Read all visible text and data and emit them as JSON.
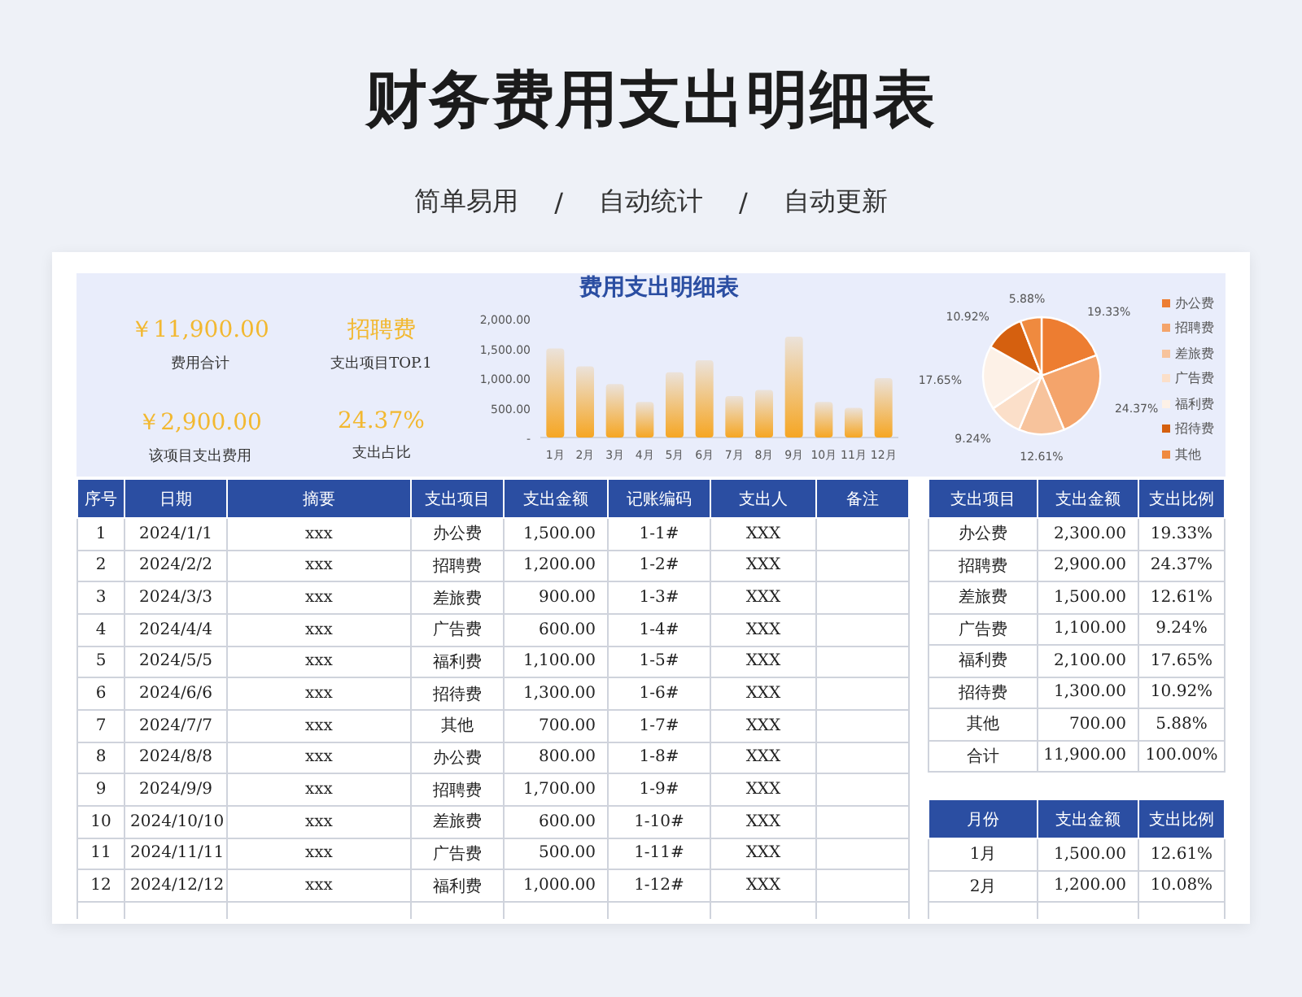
{
  "header": {
    "title": "财务费用支出明细表",
    "taglines": [
      "简单易用",
      "/",
      "自动统计",
      "/",
      "自动更新"
    ]
  },
  "dashboard": {
    "title": "费用支出明细表",
    "stats": [
      {
        "value": "￥11,900.00",
        "label": "费用合计"
      },
      {
        "value": "招聘费",
        "label": "支出项目TOP.1"
      },
      {
        "value": "￥2,900.00",
        "label": "该项目支出费用"
      },
      {
        "value": "24.37%",
        "label": "支出占比"
      }
    ],
    "bar_chart": {
      "chart_data": {
        "type": "bar",
        "categories": [
          "1月",
          "2月",
          "3月",
          "4月",
          "5月",
          "6月",
          "7月",
          "8月",
          "9月",
          "10月",
          "11月",
          "12月"
        ],
        "series": [
          {
            "color": "#f6a623",
            "values": [
              1500,
              1200,
              900,
              600,
              1100,
              1300,
              700,
              800,
              1700,
              600,
              500,
              1000
            ]
          }
        ],
        "ylim": [
          0,
          2000
        ],
        "yticks": [
          {
            "value": 0,
            "label": "-"
          },
          {
            "value": 500,
            "label": "500.00"
          },
          {
            "value": 1000,
            "label": "1,000.00"
          },
          {
            "value": 1500,
            "label": "1,500.00"
          },
          {
            "value": 2000,
            "label": "2,000.00"
          }
        ]
      }
    },
    "pie_chart": {
      "chart_data": {
        "type": "pie",
        "categories": [
          "办公费",
          "招聘费",
          "差旅费",
          "广告费",
          "福利费",
          "招待费",
          "其他"
        ],
        "series": [
          {
            "values": [
              19.33,
              24.37,
              12.61,
              9.24,
              17.65,
              10.92,
              5.88
            ]
          }
        ],
        "value_labels": [
          "19.33%",
          "24.37%",
          "12.61%",
          "9.24%",
          "17.65%",
          "10.92%",
          "5.88%"
        ]
      },
      "legend": [
        {
          "color": "#ed7d31"
        },
        {
          "color": "#f4a46b"
        },
        {
          "color": "#f7c39c"
        },
        {
          "color": "#fbdfc9"
        },
        {
          "color": "#fdf1e7"
        },
        {
          "color": "#d5600f"
        },
        {
          "color": "#ef8a3f"
        }
      ]
    }
  },
  "expense_table": {
    "columns": [
      "序号",
      "日期",
      "摘要",
      "支出项目",
      "支出金额",
      "记账编码",
      "支出人",
      "备注"
    ],
    "rows": [
      [
        "1",
        "2024/1/1",
        "xxx",
        "办公费",
        "1,500.00",
        "1-1#",
        "XXX"
      ],
      [
        "2",
        "2024/2/2",
        "xxx",
        "招聘费",
        "1,200.00",
        "1-2#",
        "XXX"
      ],
      [
        "3",
        "2024/3/3",
        "xxx",
        "差旅费",
        "900.00",
        "1-3#",
        "XXX"
      ],
      [
        "4",
        "2024/4/4",
        "xxx",
        "广告费",
        "600.00",
        "1-4#",
        "XXX"
      ],
      [
        "5",
        "2024/5/5",
        "xxx",
        "福利费",
        "1,100.00",
        "1-5#",
        "XXX"
      ],
      [
        "6",
        "2024/6/6",
        "xxx",
        "招待费",
        "1,300.00",
        "1-6#",
        "XXX"
      ],
      [
        "7",
        "2024/7/7",
        "xxx",
        "其他",
        "700.00",
        "1-7#",
        "XXX"
      ],
      [
        "8",
        "2024/8/8",
        "xxx",
        "办公费",
        "800.00",
        "1-8#",
        "XXX"
      ],
      [
        "9",
        "2024/9/9",
        "xxx",
        "招聘费",
        "1,700.00",
        "1-9#",
        "XXX"
      ],
      [
        "10",
        "2024/10/10",
        "xxx",
        "差旅费",
        "600.00",
        "1-10#",
        "XXX"
      ],
      [
        "11",
        "2024/11/11",
        "xxx",
        "广告费",
        "500.00",
        "1-11#",
        "XXX"
      ],
      [
        "12",
        "2024/12/12",
        "xxx",
        "福利费",
        "1,000.00",
        "1-12#",
        "XXX"
      ]
    ]
  },
  "category_table": {
    "columns": [
      "支出项目",
      "支出金额",
      "支出比例"
    ],
    "rows": [
      [
        "办公费",
        "2,300.00",
        "19.33%"
      ],
      [
        "招聘费",
        "2,900.00",
        "24.37%"
      ],
      [
        "差旅费",
        "1,500.00",
        "12.61%"
      ],
      [
        "广告费",
        "1,100.00",
        "9.24%"
      ],
      [
        "福利费",
        "2,100.00",
        "17.65%"
      ],
      [
        "招待费",
        "1,300.00",
        "10.92%"
      ],
      [
        "其他",
        "700.00",
        "5.88%"
      ],
      [
        "合计",
        "11,900.00",
        "100.00%"
      ]
    ]
  },
  "monthly_table": {
    "columns": [
      "月份",
      "支出金额",
      "支出比例"
    ],
    "rows": [
      [
        "1月",
        "1,500.00",
        "12.61%"
      ],
      [
        "2月",
        "1,200.00",
        "10.08%"
      ]
    ]
  }
}
